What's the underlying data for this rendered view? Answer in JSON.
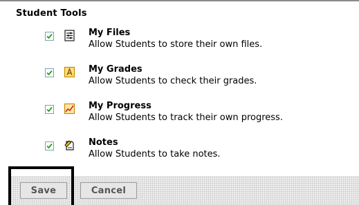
{
  "section": {
    "title": "Student Tools"
  },
  "tools": [
    {
      "name": "My Files",
      "description": "Allow Students to store their own files.",
      "checked": true,
      "icon": "files-icon"
    },
    {
      "name": "My Grades",
      "description": "Allow Students to check their grades.",
      "checked": true,
      "icon": "grades-icon"
    },
    {
      "name": "My Progress",
      "description": "Allow Students to track their own progress.",
      "checked": true,
      "icon": "progress-icon"
    },
    {
      "name": "Notes",
      "description": "Allow Students to take notes.",
      "checked": true,
      "icon": "notes-icon"
    }
  ],
  "buttons": {
    "save": "Save",
    "cancel": "Cancel"
  },
  "colors": {
    "checkbox_border": "#7f9db9",
    "checkmark": "#21a121",
    "button_bar": "#efefef"
  }
}
